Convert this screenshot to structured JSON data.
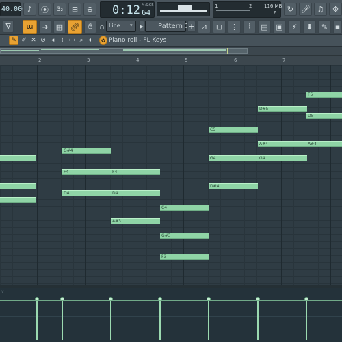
{
  "toolbar": {
    "tempo": "40.000",
    "time_main": "0:12",
    "time_sub": "64",
    "time_label": "M:S:CS",
    "cpu_left": "1",
    "cpu_right": "2",
    "memory": "116 MB",
    "poly": "6"
  },
  "toolbar2": {
    "snap": "Line",
    "pattern": "Pattern 1"
  },
  "pianoroll": {
    "title": "Piano roll - FL Keys",
    "bars": [
      "2",
      "3",
      "4",
      "5",
      "6",
      "7"
    ]
  },
  "notes": [
    {
      "label": "G#4",
      "bar": 1.52,
      "len": 1.0,
      "row": 11
    },
    {
      "label": "F4",
      "bar": 1.52,
      "len": 1.0,
      "row": 14
    },
    {
      "label": "F4",
      "bar": 2.52,
      "len": 1.0,
      "row": 14
    },
    {
      "label": "D4",
      "bar": 1.52,
      "len": 1.0,
      "row": 17
    },
    {
      "label": "D4",
      "bar": 2.52,
      "len": 1.0,
      "row": 17
    },
    {
      "label": "A#3",
      "bar": 2.52,
      "len": 1.0,
      "row": 21
    },
    {
      "label": "C4",
      "bar": 3.52,
      "len": 1.0,
      "row": 19
    },
    {
      "label": "G#3",
      "bar": 3.52,
      "len": 1.0,
      "row": 23
    },
    {
      "label": "F3",
      "bar": 3.52,
      "len": 1.0,
      "row": 26
    },
    {
      "label": "C5",
      "bar": 4.52,
      "len": 1.0,
      "row": 8
    },
    {
      "label": "G4",
      "bar": 4.52,
      "len": 1.0,
      "row": 12
    },
    {
      "label": "D#4",
      "bar": 4.52,
      "len": 1.0,
      "row": 16
    },
    {
      "label": "D#5",
      "bar": 5.52,
      "len": 1.0,
      "row": 5
    },
    {
      "label": "A#4",
      "bar": 5.52,
      "len": 1.0,
      "row": 10
    },
    {
      "label": "G4",
      "bar": 5.52,
      "len": 1.0,
      "row": 12
    },
    {
      "label": "F5",
      "bar": 6.52,
      "len": 1.0,
      "row": 3
    },
    {
      "label": "D5",
      "bar": 6.52,
      "len": 1.0,
      "row": 6
    },
    {
      "label": "A#4",
      "bar": 6.52,
      "len": 1.0,
      "row": 10
    },
    {
      "label": "",
      "bar": 0.0,
      "len": 0.75,
      "row": 12
    },
    {
      "label": "",
      "bar": 0.0,
      "len": 0.75,
      "row": 16
    },
    {
      "label": "",
      "bar": 0.0,
      "len": 0.75,
      "row": 18
    },
    {
      "label": "",
      "bar": 7.52,
      "len": 0.3,
      "row": 6
    },
    {
      "label": "",
      "bar": 7.52,
      "len": 0.3,
      "row": 10
    },
    {
      "label": "",
      "bar": 7.52,
      "len": 0.3,
      "row": 12
    }
  ],
  "velocity_positions": [
    0.75,
    1.52,
    2.52,
    3.52,
    4.52,
    5.52,
    6.52
  ]
}
